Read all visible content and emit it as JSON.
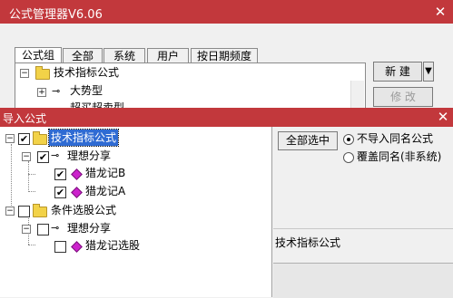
{
  "back_window": {
    "title": "公式管理器V6.06",
    "close": "✕",
    "tabs": [
      "公式组",
      "全部",
      "系统",
      "用户",
      "按日期频度"
    ],
    "tree": {
      "root": "技术指标公式",
      "child1": "大势型",
      "child2": "超买超卖型"
    },
    "buttons": {
      "new": "新 建",
      "modify": "修 改",
      "dropdown": "▼"
    }
  },
  "import_dialog": {
    "title": "导入公式",
    "close": "✕",
    "tree": [
      {
        "label": "技术指标公式",
        "checked": true,
        "selected": true
      },
      {
        "label": "理想分享",
        "checked": true
      },
      {
        "label": "猎龙记B",
        "checked": true
      },
      {
        "label": "猎龙记A",
        "checked": true
      },
      {
        "label": "条件选股公式",
        "checked": false
      },
      {
        "label": "理想分享",
        "checked": false
      },
      {
        "label": "猎龙记选股",
        "checked": false
      }
    ],
    "select_all_button": "全部选中",
    "options": [
      {
        "label": "不导入同名公式",
        "selected": true
      },
      {
        "label": "覆盖同名(非系统)",
        "selected": false
      }
    ],
    "info_label": "技术指标公式"
  },
  "colors": {
    "title_bar": "#c2383c",
    "selection": "#2f6bd3",
    "diamond": "#cc22cc"
  },
  "icons": [
    "folder-icon",
    "formula-icon",
    "expand-icon",
    "collapse-icon",
    "checkbox-icon",
    "radio-icon",
    "close-icon"
  ]
}
